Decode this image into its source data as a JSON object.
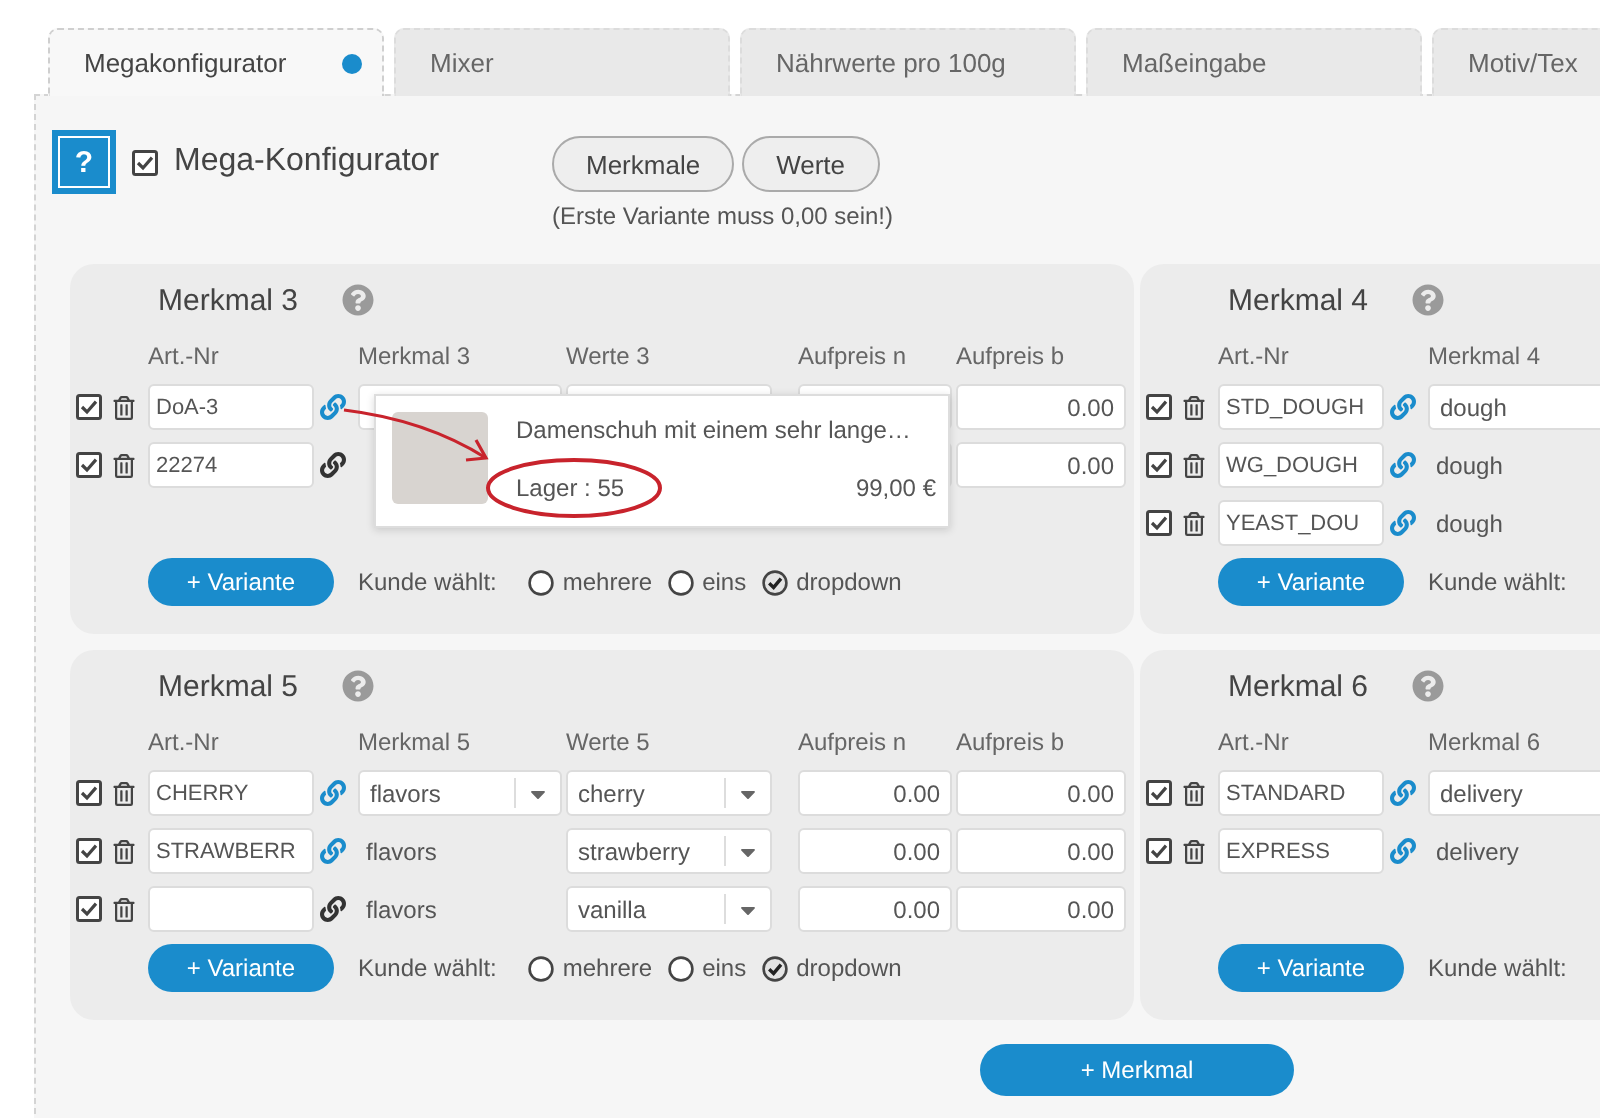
{
  "tabs": [
    {
      "label": "Megakonfigurator",
      "selected": true
    },
    {
      "label": "Mixer",
      "selected": false
    },
    {
      "label": "Nährwerte pro 100g",
      "selected": false
    },
    {
      "label": "Maßeingabe",
      "selected": false
    },
    {
      "label": "Motiv/Tex",
      "selected": false
    }
  ],
  "header": {
    "help": "?",
    "title": "Mega-Konfigurator",
    "checked": true,
    "buttons": [
      "Merkmale",
      "Werte"
    ],
    "note": "(Erste Variante muss 0,00 sein!)"
  },
  "cards": [
    {
      "title": "Merkmal 3",
      "columns": [
        "Art.-Nr",
        "Merkmal 3",
        "Werte 3",
        "Aufpreis n",
        "Aufpreis b"
      ],
      "rows": [
        {
          "checked": true,
          "linked": true,
          "cells": [
            {
              "kind": "article",
              "value": "DoA-3"
            },
            {
              "kind": "input"
            },
            {
              "kind": "input"
            },
            {
              "kind": "number"
            },
            {
              "kind": "number",
              "value": "0.00"
            }
          ]
        },
        {
          "checked": true,
          "linked": false,
          "cells": [
            {
              "kind": "article",
              "value": "22274"
            },
            {
              "kind": "text"
            },
            {
              "kind": "input"
            },
            {
              "kind": "number"
            },
            {
              "kind": "number",
              "value": "0.00"
            }
          ]
        }
      ],
      "variant_button": "+ Variante",
      "choice_label": "Kunde wählt:",
      "choices": [
        {
          "label": "mehrere",
          "selected": false
        },
        {
          "label": "eins",
          "selected": false
        },
        {
          "label": "dropdown",
          "selected": true
        }
      ],
      "popup": {
        "title": "Damenschuh mit einem sehr lange…",
        "stock": "Lager : 55",
        "price": "99,00 €"
      }
    },
    {
      "title": "Merkmal 4",
      "columns": [
        "Art.-Nr",
        "Merkmal 4"
      ],
      "rows": [
        {
          "checked": true,
          "linked": true,
          "cells": [
            {
              "kind": "article",
              "value": "STD_DOUGH"
            },
            {
              "kind": "input",
              "value": "dough"
            }
          ]
        },
        {
          "checked": true,
          "linked": true,
          "cells": [
            {
              "kind": "article",
              "value": "WG_DOUGH"
            },
            {
              "kind": "text",
              "value": "dough"
            }
          ]
        },
        {
          "checked": true,
          "linked": true,
          "cells": [
            {
              "kind": "article",
              "value": "YEAST_DOU"
            },
            {
              "kind": "text",
              "value": "dough"
            }
          ]
        }
      ],
      "variant_button": "+ Variante",
      "choice_label": "Kunde wählt:"
    },
    {
      "title": "Merkmal 5",
      "columns": [
        "Art.-Nr",
        "Merkmal 5",
        "Werte 5",
        "Aufpreis n",
        "Aufpreis b"
      ],
      "rows": [
        {
          "checked": true,
          "linked": true,
          "cells": [
            {
              "kind": "article",
              "value": "CHERRY"
            },
            {
              "kind": "select",
              "value": "flavors"
            },
            {
              "kind": "select",
              "value": "cherry"
            },
            {
              "kind": "number",
              "value": "0.00"
            },
            {
              "kind": "number",
              "value": "0.00"
            }
          ]
        },
        {
          "checked": true,
          "linked": true,
          "cells": [
            {
              "kind": "article",
              "value": "STRAWBERR"
            },
            {
              "kind": "text",
              "value": "flavors"
            },
            {
              "kind": "select",
              "value": "strawberry"
            },
            {
              "kind": "number",
              "value": "0.00"
            },
            {
              "kind": "number",
              "value": "0.00"
            }
          ]
        },
        {
          "checked": true,
          "linked": false,
          "cells": [
            {
              "kind": "article"
            },
            {
              "kind": "text",
              "value": "flavors"
            },
            {
              "kind": "select",
              "value": "vanilla"
            },
            {
              "kind": "number",
              "value": "0.00"
            },
            {
              "kind": "number",
              "value": "0.00"
            }
          ]
        }
      ],
      "variant_button": "+ Variante",
      "choice_label": "Kunde wählt:",
      "choices": [
        {
          "label": "mehrere",
          "selected": false
        },
        {
          "label": "eins",
          "selected": false
        },
        {
          "label": "dropdown",
          "selected": true
        }
      ]
    },
    {
      "title": "Merkmal 6",
      "columns": [
        "Art.-Nr",
        "Merkmal 6"
      ],
      "rows": [
        {
          "checked": true,
          "linked": true,
          "cells": [
            {
              "kind": "article",
              "value": "STANDARD"
            },
            {
              "kind": "input",
              "value": "delivery"
            }
          ]
        },
        {
          "checked": true,
          "linked": true,
          "cells": [
            {
              "kind": "article",
              "value": "EXPRESS"
            },
            {
              "kind": "text",
              "value": "delivery"
            }
          ]
        }
      ],
      "variant_button": "+ Variante",
      "choice_label": "Kunde wählt:"
    }
  ],
  "add_button": "+ Merkmal"
}
